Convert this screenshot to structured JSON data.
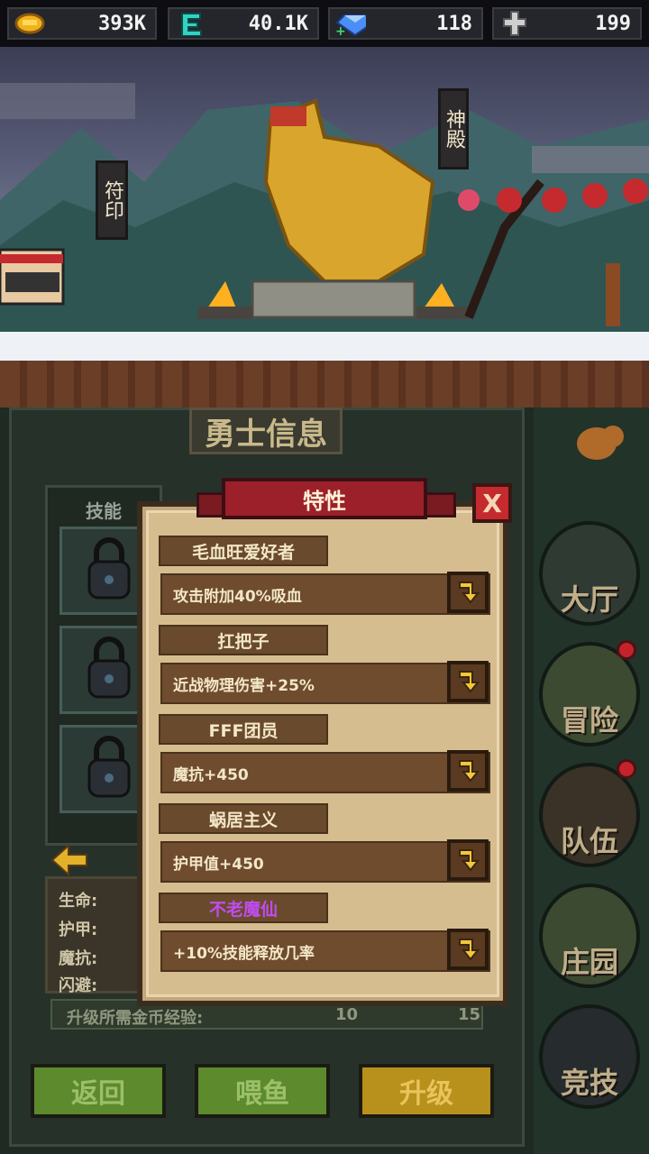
{
  "resources": [
    {
      "icon": "gold-coin-icon",
      "value": "393K"
    },
    {
      "icon": "energy-e-icon",
      "value": "40.1K"
    },
    {
      "icon": "diamond-icon",
      "value": "118"
    },
    {
      "icon": "cross-icon",
      "value": "199"
    }
  ],
  "scene": {
    "sign_left": "符印",
    "sign_right": "神殿"
  },
  "hero_panel": {
    "title": "勇士信息",
    "skills_label": "技能",
    "stats": [
      "生命:",
      "护甲:",
      "魔抗:",
      "闪避:"
    ],
    "upgrade_cost_label": "升级所需金币经验:",
    "upgrade_cost_values": [
      "10",
      "15"
    ]
  },
  "buttons": {
    "back": "返回",
    "feed": "喂鱼",
    "upgrade": "升级"
  },
  "nav": [
    {
      "label": "大厅",
      "icon": "hall-icon",
      "badge": false
    },
    {
      "label": "冒险",
      "icon": "adventure-icon",
      "badge": true
    },
    {
      "label": "队伍",
      "icon": "team-icon",
      "badge": true
    },
    {
      "label": "庄园",
      "icon": "manor-icon",
      "badge": false
    },
    {
      "label": "竞技",
      "icon": "arena-icon",
      "badge": false
    }
  ],
  "traits_modal": {
    "title": "特性",
    "close_label": "X",
    "traits": [
      {
        "name": "毛血旺爱好者",
        "desc": "攻击附加40%吸血",
        "name_color": "#f3e7c8"
      },
      {
        "name": "扛把子",
        "desc": "近战物理伤害+25%",
        "name_color": "#f3e7c8"
      },
      {
        "name": "FFF团员",
        "desc": "魔抗+450",
        "name_color": "#f3e7c8"
      },
      {
        "name": "蜗居主义",
        "desc": "护甲值+450",
        "name_color": "#f3e7c8"
      },
      {
        "name": "不老魔仙",
        "desc": "+10%技能释放几率",
        "name_color": "#c04cf0"
      }
    ]
  },
  "colors": {
    "accent_red": "#9c2029",
    "gold": "#f4c63a",
    "purple_trait": "#c04cf0"
  }
}
